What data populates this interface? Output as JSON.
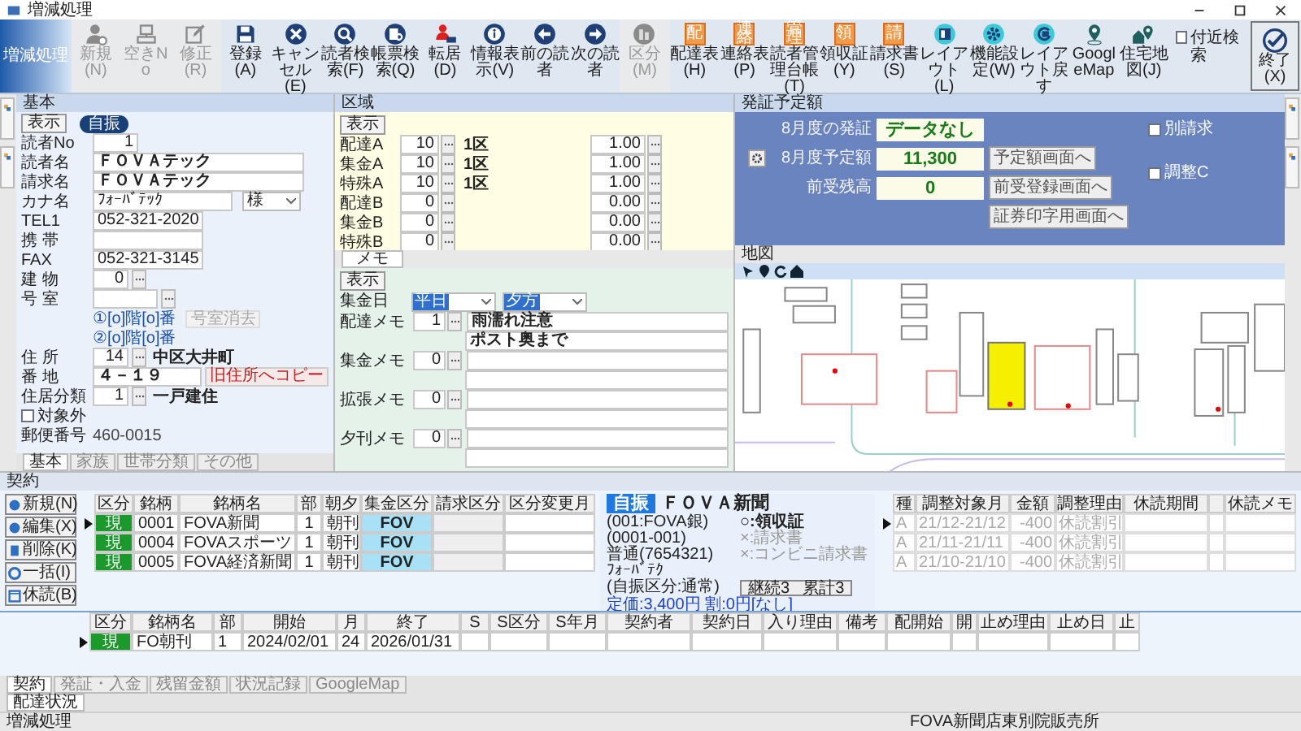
{
  "window": {
    "title": "増減処理"
  },
  "toolbar": {
    "logo": "増減処理",
    "buttons": [
      {
        "label": "新規(N)",
        "kind": "user",
        "disabled": true
      },
      {
        "label": "空きNo",
        "kind": "terminal",
        "disabled": true
      },
      {
        "label": "修正(R)",
        "kind": "edit",
        "disabled": true
      },
      {
        "label": "登録(A)",
        "kind": "save",
        "disabled": false
      },
      {
        "label": "キャンセル(E)",
        "kind": "cancel",
        "disabled": false
      },
      {
        "label": "読者検索(F)",
        "kind": "search",
        "disabled": false
      },
      {
        "label": "帳票検索(Q)",
        "kind": "docsearch",
        "disabled": false
      },
      {
        "label": "転居(D)",
        "kind": "move",
        "disabled": false
      },
      {
        "label": "情報表示(V)",
        "kind": "info",
        "disabled": false
      },
      {
        "label": "前の読者",
        "kind": "prev",
        "disabled": false
      },
      {
        "label": "次の読者",
        "kind": "next",
        "disabled": false
      },
      {
        "label": "区分(M)",
        "kind": "building",
        "disabled": true
      },
      {
        "label": "配達表(H)",
        "kind": "doc",
        "badge": "配",
        "disabled": false
      },
      {
        "label": "連絡表(P)",
        "kind": "doc",
        "badge": "連絡",
        "disabled": false
      },
      {
        "label": "読者管理台帳(T)",
        "kind": "doc",
        "badge": "管理",
        "disabled": false
      },
      {
        "label": "領収証(Y)",
        "kind": "doc",
        "badge": "領",
        "disabled": false
      },
      {
        "label": "請求書(S)",
        "kind": "doc",
        "badge": "請",
        "disabled": false
      },
      {
        "label": "レイアウト(L)",
        "kind": "layout",
        "disabled": false
      },
      {
        "label": "機能設定(W)",
        "kind": "gear",
        "disabled": false
      },
      {
        "label": "レイアウト戻す",
        "kind": "reset",
        "disabled": false
      },
      {
        "label": "GoogleMap",
        "kind": "pin",
        "disabled": false
      },
      {
        "label": "住宅地図(J)",
        "kind": "house",
        "disabled": false
      }
    ],
    "nearby_search": {
      "label": "付近検索",
      "checked": false
    },
    "exit": {
      "label": "終了(X)"
    }
  },
  "reader_panel": {
    "title": "基本",
    "show_button": "表示",
    "payment_badge": "自振",
    "rows": [
      {
        "kind": "number",
        "label": "読者No",
        "value": "1"
      },
      {
        "kind": "text",
        "label": "読者名",
        "value": "ＦＯＶＡテック"
      },
      {
        "kind": "text",
        "label": "請求名",
        "value": "ＦＯＶＡテック"
      },
      {
        "kind": "kana",
        "label": "カナ名",
        "value": "ﾌｫｰﾊﾞﾃｯｸ",
        "honorific": "様"
      },
      {
        "kind": "phone",
        "label": "TEL1",
        "value": "052-321-2020"
      },
      {
        "kind": "phone",
        "label": "携 帯"
      },
      {
        "kind": "phone",
        "label": "FAX",
        "value": "052-321-3145"
      },
      {
        "kind": "code",
        "label": "建 物",
        "value": "0"
      },
      {
        "kind": "room",
        "label": "号 室"
      },
      {
        "kind": "link",
        "text": "①[o]階[o]番",
        "button": "号室消去"
      },
      {
        "kind": "link",
        "text": "②[o]階[o]番"
      },
      {
        "kind": "code",
        "label": "住 所",
        "value": "14",
        "name": "中区大井町"
      },
      {
        "kind": "text",
        "label": "番 地",
        "value": "４－１９",
        "button": "旧住所へコピー"
      },
      {
        "kind": "code",
        "label": "住居分類",
        "value": "1",
        "name": "一戸建住"
      },
      {
        "kind": "checkbox",
        "label": "対象外",
        "checked": false
      },
      {
        "kind": "plain",
        "label": "郵便番号",
        "value": "460-0015"
      }
    ],
    "tabs": [
      {
        "label": "基本",
        "selected": true
      },
      {
        "label": "家族",
        "selected": false
      },
      {
        "label": "世帯分類",
        "selected": false
      },
      {
        "label": "その他",
        "selected": false
      }
    ]
  },
  "area_panel": {
    "title": "区域",
    "show_button": "表示",
    "rows": [
      {
        "label": "配達A",
        "value": "10",
        "area": "1区",
        "rate": "1.00"
      },
      {
        "label": "集金A",
        "value": "10",
        "area": "1区",
        "rate": "1.00"
      },
      {
        "label": "特殊A",
        "value": "10",
        "area": "1区",
        "rate": "1.00"
      },
      {
        "label": "配達B",
        "value": "0",
        "rate": "0.00"
      },
      {
        "label": "集金B",
        "value": "0",
        "rate": "0.00"
      },
      {
        "label": "特殊B",
        "value": "0",
        "rate": "0.00"
      }
    ]
  },
  "memo_panel": {
    "tab": "メモ",
    "show_button": "表示",
    "collection_day": {
      "label": "集金日",
      "day": "平日",
      "time": "夕方"
    },
    "memos": [
      {
        "label": "配達メモ",
        "count": "1",
        "lines": [
          "雨濡れ注意",
          "ポスト奥まで"
        ]
      },
      {
        "label": "集金メモ",
        "count": "0"
      },
      {
        "label": "拡張メモ",
        "count": "0"
      },
      {
        "label": "夕刊メモ",
        "count": "0"
      }
    ]
  },
  "billing_panel": {
    "title": "発証予定額",
    "rows": [
      {
        "label": "8月度の発証",
        "value": "データなし",
        "gear": false
      },
      {
        "label": "8月度予定額",
        "value": "11,300",
        "button": "予定額画面へ",
        "gear": true
      },
      {
        "label": "前受残高",
        "value": "0",
        "button": "前受登録画面へ",
        "gear": false
      }
    ],
    "print_button": "証券印字用画面へ",
    "checks": [
      {
        "label": "別請求",
        "checked": false
      },
      {
        "label": "調整C",
        "checked": false
      }
    ]
  },
  "map_panel": {
    "title": "地図"
  },
  "contract": {
    "title": "契約",
    "buttons": [
      {
        "label": "新規(N)",
        "kind": "new"
      },
      {
        "label": "編集(X)",
        "kind": "edit"
      },
      {
        "label": "削除(K)",
        "kind": "delete"
      },
      {
        "label": "一括(I)",
        "kind": "batch"
      },
      {
        "label": "休読(B)",
        "kind": "calendar"
      }
    ],
    "columns": [
      "区分",
      "銘柄",
      "銘柄名",
      "部",
      "朝夕",
      "集金区分",
      "請求区分",
      "区分変更月"
    ],
    "rows": [
      {
        "status": "現",
        "code": "0001",
        "name": "FOVA新聞",
        "copies": "1",
        "edition": "朝刊",
        "collection": "FOV",
        "selected": true
      },
      {
        "status": "現",
        "code": "0004",
        "name": "FOVAスポーツ",
        "copies": "1",
        "edition": "朝刊",
        "collection": "FOV",
        "selected": false
      },
      {
        "status": "現",
        "code": "0005",
        "name": "FOVA経済新聞",
        "copies": "1",
        "edition": "朝刊",
        "collection": "FOV",
        "selected": false
      }
    ],
    "info": {
      "badge": "自振",
      "paper": "ＦＯＶＡ新聞",
      "lines": [
        "(001:FOVA銀)",
        "(0001-001)",
        "普通(7654321)",
        "ﾌｫｰﾊﾞﾃｸ",
        "(自振区分:通常)"
      ],
      "documents": [
        {
          "text": "○:領収証",
          "active": true
        },
        {
          "text": "×:請求書",
          "active": false
        },
        {
          "text": "×:コンビニ請求書",
          "active": false
        }
      ],
      "price": "定価:3,400円 割:0円[なし]",
      "counts": [
        "継続3",
        "累計3"
      ]
    },
    "adjustments": {
      "columns": [
        "種",
        "調整対象月",
        "金額",
        "調整理由",
        "休読期間",
        "休読メモ"
      ],
      "rows": [
        {
          "type": "A",
          "month": "21/12-21/12",
          "amount": "-400",
          "reason": "休読割引",
          "selected": true
        },
        {
          "type": "A",
          "month": "21/11-21/11",
          "amount": "-400",
          "reason": "休読割引",
          "selected": false
        },
        {
          "type": "A",
          "month": "21/10-21/10",
          "amount": "-400",
          "reason": "休読割引",
          "selected": false
        }
      ]
    },
    "subscriptions": {
      "columns": [
        "区分",
        "銘柄名",
        "部",
        "開始",
        "月",
        "終了",
        "S",
        "S区分",
        "S年月",
        "契約者",
        "契約日",
        "入り理由",
        "備考",
        "配開始",
        "開",
        "止め理由",
        "止め日",
        "止"
      ],
      "rows": [
        {
          "status": "現",
          "values": [
            "FO朝刊",
            "1",
            "2024/02/01",
            "24",
            "2026/01/31"
          ],
          "selected": true
        }
      ]
    },
    "tabs": [
      {
        "label": "契約",
        "selected": true
      },
      {
        "label": "発証・入金",
        "selected": false
      },
      {
        "label": "残留金額",
        "selected": false
      },
      {
        "label": "状況記録",
        "selected": false
      },
      {
        "label": "GoogleMap",
        "selected": false
      }
    ],
    "tabs_2": [
      {
        "label": "配達状況",
        "selected": true
      }
    ]
  },
  "status_bar": {
    "left": "増減処理",
    "right": "FOVA新聞店東別院販売所"
  }
}
